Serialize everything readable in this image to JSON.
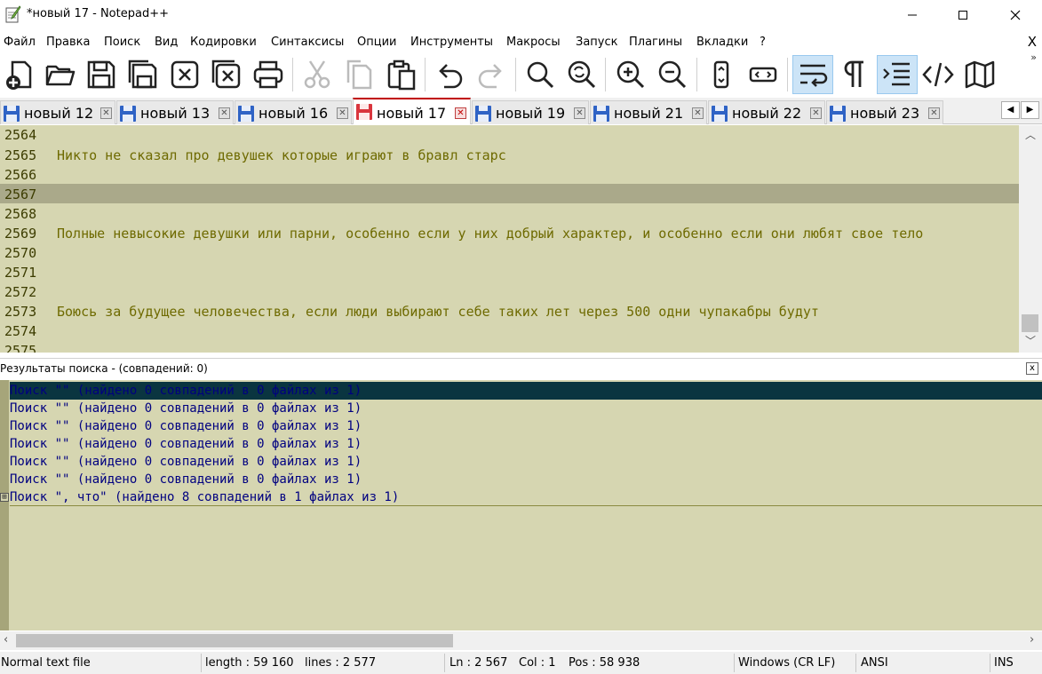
{
  "window": {
    "title": "*новый 17 - Notepad++"
  },
  "menu": [
    "Файл",
    "Правка",
    "Поиск",
    "Вид",
    "Кодировки",
    "Синтаксисы",
    "Опции",
    "Инструменты",
    "Макросы",
    "Запуск",
    "Плагины",
    "Вкладки",
    "?"
  ],
  "menu_close": "X",
  "toolbar": {
    "buttons": [
      "new-file",
      "open-folder",
      "save",
      "save-all",
      "close",
      "close-all",
      "print",
      "cut",
      "copy",
      "paste",
      "undo",
      "redo",
      "find",
      "replace",
      "zoom-in",
      "zoom-out",
      "sync-scroll",
      "sync-horizontal",
      "word-wrap",
      "show-all-chars",
      "indent-guide",
      "html-tag",
      "doc-map"
    ],
    "active": [
      "word-wrap",
      "indent-guide"
    ],
    "overflow": "»"
  },
  "tabs": [
    {
      "label": "новый 12",
      "active": false,
      "modified": false
    },
    {
      "label": "новый 13",
      "active": false,
      "modified": false
    },
    {
      "label": "новый 16",
      "active": false,
      "modified": false
    },
    {
      "label": "новый 17",
      "active": true,
      "modified": true
    },
    {
      "label": "новый 19",
      "active": false,
      "modified": false
    },
    {
      "label": "новый 21",
      "active": false,
      "modified": false
    },
    {
      "label": "новый 22",
      "active": false,
      "modified": false
    },
    {
      "label": "новый 23",
      "active": false,
      "modified": false
    }
  ],
  "editor": {
    "lines": [
      {
        "n": "2564",
        "text": ""
      },
      {
        "n": "2565",
        "text": "Никто не сказал про девушек которые играют в бравл старс"
      },
      {
        "n": "2566",
        "text": ""
      },
      {
        "n": "2567",
        "text": "",
        "current": true
      },
      {
        "n": "2568",
        "text": ""
      },
      {
        "n": "2569",
        "text": "Полные невысокие девушки или парни, особенно если у них добрый характер, и особенно если они любят свое тело"
      },
      {
        "n": "2570",
        "text": ""
      },
      {
        "n": "2571",
        "text": ""
      },
      {
        "n": "2572",
        "text": ""
      },
      {
        "n": "2573",
        "text": "Боюсь за будущее человечества, если люди выбирают себе таких лет через 500 одни чупакабры будут"
      },
      {
        "n": "2574",
        "text": ""
      },
      {
        "n": "2575",
        "text": ""
      }
    ]
  },
  "search_panel": {
    "title": "Результаты поиска - (совпадений: 0)",
    "close": "x",
    "results": [
      "Поиск \"\" (найдено 0 совпадений в 0 файлах из 1)",
      "Поиск \"\" (найдено 0 совпадений в 0 файлах из 1)",
      "Поиск \"\" (найдено 0 совпадений в 0 файлах из 1)",
      "Поиск \"\" (найдено 0 совпадений в 0 файлах из 1)",
      "Поиск \"\" (найдено 0 совпадений в 0 файлах из 1)",
      "Поиск \"\" (найдено 0 совпадений в 0 файлах из 1)",
      "Поиск \", что\" (найдено 8 совпадений в 1 файлах из 1)"
    ],
    "fold_symbol": "⊞"
  },
  "status": {
    "type": "Normal text file",
    "length": "length : 59 160",
    "lines": "lines : 2 577",
    "ln": "Ln : 2 567",
    "col": "Col : 1",
    "pos": "Pos : 58 938",
    "eol": "Windows (CR LF)",
    "encoding": "ANSI",
    "mode": "INS"
  },
  "colors": {
    "editor_bg": "#d6d6b1",
    "current_line": "#aaa98a",
    "text": "#6e6a00",
    "result_text": "#000080",
    "selected_result": "#0a3540",
    "active_tab_accent": "#c00000"
  }
}
